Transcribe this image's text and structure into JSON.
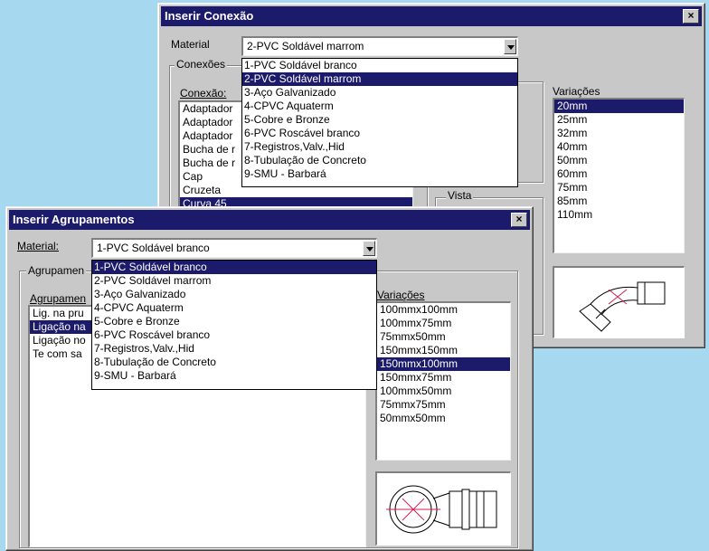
{
  "materials": [
    "1-PVC Soldável branco",
    "2-PVC Soldável marrom",
    "3-Aço Galvanizado",
    "4-CPVC Aquaterm",
    "5-Cobre e Bronze",
    "6-PVC Roscável branco",
    "7-Registros,Valv.,Hid",
    "8-Tubulação de Concreto",
    "9-SMU - Barbará"
  ],
  "conexao": {
    "title": "Inserir Conexão",
    "close": "×",
    "material_label": "Material",
    "material_value": "2-PVC Soldável marrom",
    "conexoes_group": "Conexões",
    "conexao_label": "Conexão:",
    "conexao_items": [
      "Adaptador",
      "Adaptador",
      "Adaptador",
      "Bucha de r",
      "Bucha de r",
      "Cap",
      "Cruzeta",
      "Curva 45"
    ],
    "selected_conexao_index": 7,
    "vista_label": "Vista",
    "variacoes_label": "Variações",
    "variacoes": [
      "20mm",
      "25mm",
      "32mm",
      "40mm",
      "50mm",
      "60mm",
      "75mm",
      "85mm",
      "110mm"
    ],
    "selected_variacao_index": 0,
    "dropdown_selected_index": 1
  },
  "agrupamentos": {
    "title": "Inserir Agrupamentos",
    "close": "×",
    "material_label": "Material:",
    "material_value": "1-PVC Soldável branco",
    "group_label": "Agrupamen",
    "list_label": "Agrupamen",
    "items": [
      "Lig. na pru",
      "Ligação na",
      "Ligação no",
      "Te com sa"
    ],
    "selected_index": 1,
    "variacoes_label": "Variações",
    "variacoes": [
      "100mmx100mm",
      "100mmx75mm",
      "75mmx50mm",
      "150mmx150mm",
      "150mmx100mm",
      "150mmx75mm",
      "100mmx50mm",
      "75mmx75mm",
      "50mmx50mm"
    ],
    "selected_variacao_index": 4,
    "dropdown_selected_index": 0
  }
}
